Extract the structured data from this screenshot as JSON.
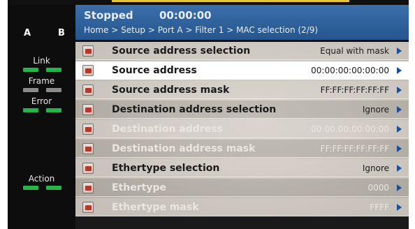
{
  "header": {
    "status": "Stopped",
    "timer": "00:00:00",
    "breadcrumb": "Home > Setup > Port A > Filter 1 > MAC selection (2/9)"
  },
  "ports": [
    "A",
    "B"
  ],
  "leds": {
    "link_label": "Link",
    "frame_label": "Frame",
    "error_label": "Error",
    "action_label": "Action",
    "colors": {
      "green": "#27b24a",
      "grey": "#8a8a8a"
    }
  },
  "rows": [
    {
      "label": "Source address selection",
      "value": "Equal with mask"
    },
    {
      "label": "Source address",
      "value": "00:00:00:00:00:00"
    },
    {
      "label": "Source address mask",
      "value": "FF:FF:FF:FF:FF:FF"
    },
    {
      "label": "Destination address selection",
      "value": "Ignore"
    },
    {
      "label": "Destination address",
      "value": "00:00:00:00:00:00"
    },
    {
      "label": "Destination address mask",
      "value": "FF:FF:FF:FF:FF:FF"
    },
    {
      "label": "Ethertype selection",
      "value": "Ignore"
    },
    {
      "label": "Ethertype",
      "value": "0000"
    },
    {
      "label": "Ethertype mask",
      "value": "FFFF"
    }
  ]
}
